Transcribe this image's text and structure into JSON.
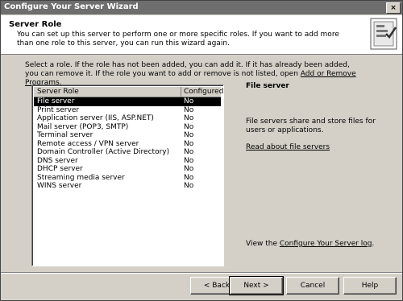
{
  "window": {
    "title": "Configure Your Server Wizard",
    "close_glyph": "×"
  },
  "header": {
    "title": "Server Role",
    "subtitle": "You can set up this server to perform one or more specific roles. If you want to add more than one role to this server, you can run this wizard again."
  },
  "instructions": {
    "text_before_link": "Select a role. If the role has not been added, you can add it. If it has already been added, you can remove it. If the role you want to add or remove is not listed, open ",
    "link": "Add or Remove Programs",
    "text_after_link": "."
  },
  "listbox": {
    "columns": [
      "Server Role",
      "Configured"
    ],
    "rows": [
      {
        "role": "File server",
        "configured": "No",
        "selected": true
      },
      {
        "role": "Print server",
        "configured": "No"
      },
      {
        "role": "Application server (IIS, ASP.NET)",
        "configured": "No"
      },
      {
        "role": "Mail server (POP3, SMTP)",
        "configured": "No"
      },
      {
        "role": "Terminal server",
        "configured": "No"
      },
      {
        "role": "Remote access / VPN server",
        "configured": "No"
      },
      {
        "role": "Domain Controller (Active Directory)",
        "configured": "No"
      },
      {
        "role": "DNS server",
        "configured": "No"
      },
      {
        "role": "DHCP server",
        "configured": "No"
      },
      {
        "role": "Streaming media server",
        "configured": "No"
      },
      {
        "role": "WINS server",
        "configured": "No"
      }
    ]
  },
  "detail": {
    "title": "File server",
    "description": "File servers share and store files for users or applications.",
    "link": "Read about file servers"
  },
  "log": {
    "prefix": "View the ",
    "link": "Configure Your Server log",
    "suffix": "."
  },
  "buttons": {
    "back": "< Back",
    "next": "Next >",
    "cancel": "Cancel",
    "help": "Help"
  },
  "icons": {
    "wizard": "wizard-server-icon"
  }
}
